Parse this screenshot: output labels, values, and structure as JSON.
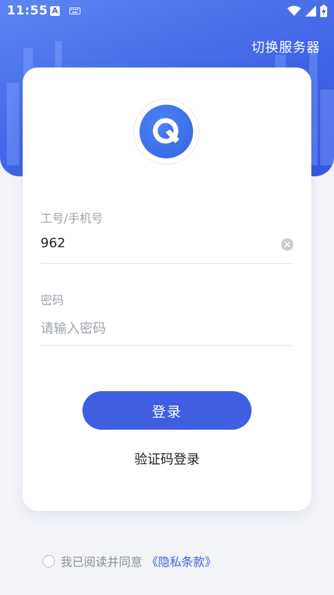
{
  "status_bar": {
    "time": "11:55",
    "ime_indicator": "A",
    "icons": [
      "keyboard-icon",
      "wifi-icon",
      "signal-icon",
      "battery-charging-icon"
    ]
  },
  "header": {
    "switch_server_label": "切换服务器"
  },
  "colors": {
    "primary": "#3f5ee0",
    "hero_gradient_start": "#5c86f2",
    "hero_gradient_end": "#3657e2",
    "background": "#f3f4f8"
  },
  "form": {
    "account": {
      "label": "工号/手机号",
      "value": "962"
    },
    "password": {
      "label": "密码",
      "placeholder": "请输入密码"
    },
    "login_button": "登录",
    "sms_login_link": "验证码登录"
  },
  "agreement": {
    "text": "我已阅读并同意",
    "link_text": "《隐私条款》"
  }
}
